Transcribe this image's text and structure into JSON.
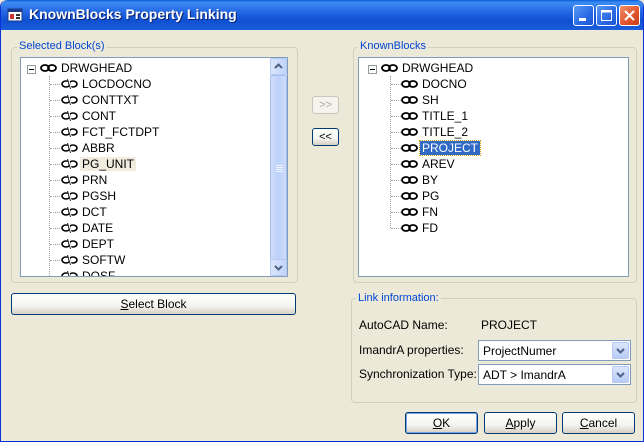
{
  "window": {
    "title": "KnownBlocks Property Linking"
  },
  "left_panel": {
    "group_label": "Selected Block(s)",
    "root": "DRWGHEAD",
    "items": [
      "LOCDOCNO",
      "CONTTXT",
      "CONT",
      "FCT_FCTDPT",
      "ABBR",
      "PG_UNIT",
      "PRN",
      "PGSH",
      "DCT",
      "DATE",
      "DEPT",
      "SOFTW",
      "DOSF"
    ],
    "hover_item": "PG_UNIT"
  },
  "right_panel": {
    "group_label": "KnownBlocks",
    "root": "DRWGHEAD",
    "items": [
      "DOCNO",
      "SH",
      "TITLE_1",
      "TITLE_2",
      "PROJECT",
      "AREV",
      "BY",
      "PG",
      "FN",
      "FD"
    ],
    "selected_item": "PROJECT"
  },
  "middle": {
    "add_label": ">>",
    "remove_label": "<<"
  },
  "select_block": {
    "mnemonic": "S",
    "rest": "elect Block"
  },
  "link_info": {
    "group_label": "Link information:",
    "autocad_label": "AutoCAD Name:",
    "autocad_value": "PROJECT",
    "imandra_label": "ImandrA properties:",
    "imandra_value": "ProjectNumer",
    "sync_label": "Synchronization Type:",
    "sync_value": "ADT > ImandrA"
  },
  "footer": {
    "ok_mnemonic": "O",
    "ok_rest": "K",
    "apply_mnemonic": "A",
    "apply_rest": "pply",
    "cancel_mnemonic": "C",
    "cancel_rest": "ancel"
  },
  "colors": {
    "accent": "#316ac5",
    "group_label": "#0046d5",
    "face": "#ece9d8"
  }
}
